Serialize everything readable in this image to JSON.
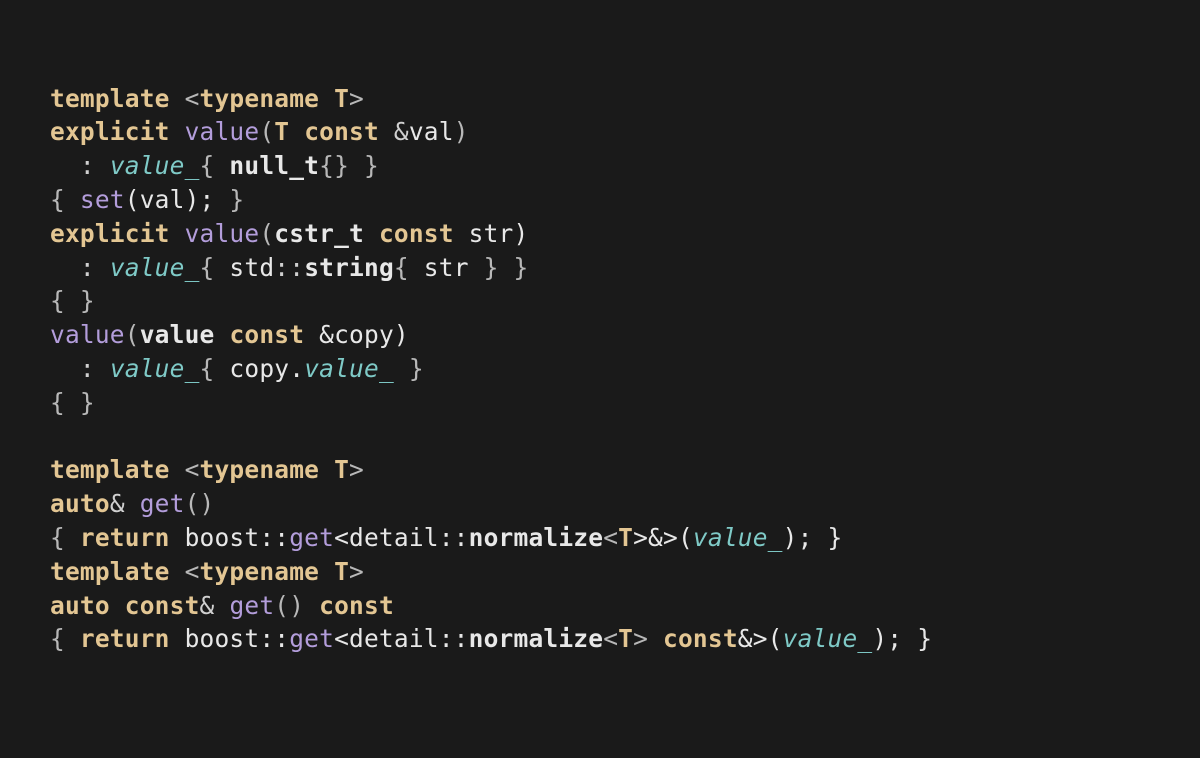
{
  "code": {
    "l1": {
      "a": "template",
      "b": "<",
      "c": "typename",
      "d": "T",
      "e": ">"
    },
    "l2": {
      "a": "explicit",
      "b": "value",
      "c": "(",
      "d": "T",
      "e": "const",
      "f": "&",
      "g": "val",
      "h": ")"
    },
    "l3": {
      "a": ":",
      "b": "value_",
      "c": "{",
      "d": "null_t",
      "e": "{}",
      "f": "}"
    },
    "l4": {
      "a": "{",
      "b": "set",
      "c": "(val);",
      "d": "}"
    },
    "l5": {
      "a": "explicit",
      "b": "value",
      "c": "(",
      "d": "cstr_t",
      "e": "const",
      "f": "str)"
    },
    "l6": {
      "a": ":",
      "b": "value_",
      "c": "{",
      "d": "std",
      "e": "::",
      "f": "string",
      "g": "{",
      "h": "str",
      "i": "} }"
    },
    "l7": {
      "a": "{ }"
    },
    "l8": {
      "a": "value",
      "b": "(",
      "c": "value",
      "d": "const",
      "e": "&copy)"
    },
    "l9": {
      "a": ":",
      "b": "value_",
      "c": "{",
      "d": "copy.",
      "e": "value_",
      "f": "}"
    },
    "l10": {
      "a": "{ }"
    },
    "l11": {
      "a": "template",
      "b": "<",
      "c": "typename",
      "d": "T",
      "e": ">"
    },
    "l12": {
      "a": "auto",
      "b": "&",
      "c": "get",
      "d": "()"
    },
    "l13": {
      "a": "{",
      "b": "return",
      "c": "boost::",
      "d": "get",
      "e": "<detail::",
      "f": "normalize",
      "g": "<",
      "h": "T",
      "i": ">&>(",
      "j": "value_",
      "k": "); }"
    },
    "l14": {
      "a": "template",
      "b": "<",
      "c": "typename",
      "d": "T",
      "e": ">"
    },
    "l15": {
      "a": "auto",
      "b": "const",
      "c": "&",
      "d": "get",
      "e": "()",
      "f": "const"
    },
    "l16": {
      "a": "{",
      "b": "return",
      "c": "boost::",
      "d": "get",
      "e": "<detail::",
      "f": "normalize",
      "g": "<",
      "h": "T",
      "i": ">",
      "j": "const",
      "k": "&>(",
      "l": "value_",
      "m": "); }"
    }
  }
}
